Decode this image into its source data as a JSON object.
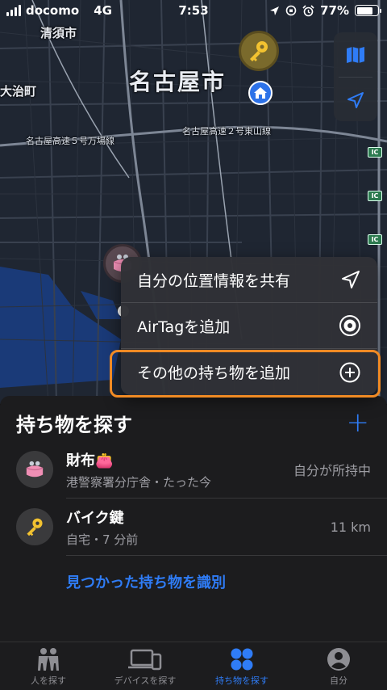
{
  "status_bar": {
    "carrier": "docomo",
    "network": "4G",
    "time": "7:53",
    "battery": "77%",
    "battery_level": 0.77
  },
  "map": {
    "city_label": "名古屋市",
    "labels": [
      "清須市",
      "大治町"
    ],
    "highway_labels": [
      "名古屋高速５号万場線",
      "名古屋高速２号東山線"
    ],
    "ic_badge": "IC"
  },
  "map_controls": {
    "map_icon": "map-icon",
    "location_icon": "location-arrow-icon"
  },
  "popup": {
    "items": [
      {
        "label": "自分の位置情報を共有",
        "icon": "location-arrow-icon"
      },
      {
        "label": "AirTagを追加",
        "icon": "airtag-icon"
      },
      {
        "label": "その他の持ち物を追加",
        "icon": "plus-circle-icon"
      }
    ]
  },
  "sheet": {
    "title": "持ち物を探す",
    "add_label": "+",
    "items": [
      {
        "name": "財布👛",
        "subtitle": "港警察署分庁舎・たった今",
        "detail": "自分が所持中",
        "icon": "purse-icon"
      },
      {
        "name": "バイク鍵",
        "subtitle": "自宅・7 分前",
        "detail": "11 km",
        "icon": "key-icon"
      }
    ],
    "identify_link": "見つかった持ち物を識別"
  },
  "tabs": [
    {
      "label": "人を探す",
      "icon": "people-icon",
      "active": false
    },
    {
      "label": "デバイスを探す",
      "icon": "devices-icon",
      "active": false
    },
    {
      "label": "持ち物を探す",
      "icon": "items-icon",
      "active": true
    },
    {
      "label": "自分",
      "icon": "person-icon",
      "active": false
    }
  ],
  "colors": {
    "accent": "#2f7cf6",
    "highlight_border": "#f08a24",
    "sheet_bg": "#1c1c1e"
  }
}
